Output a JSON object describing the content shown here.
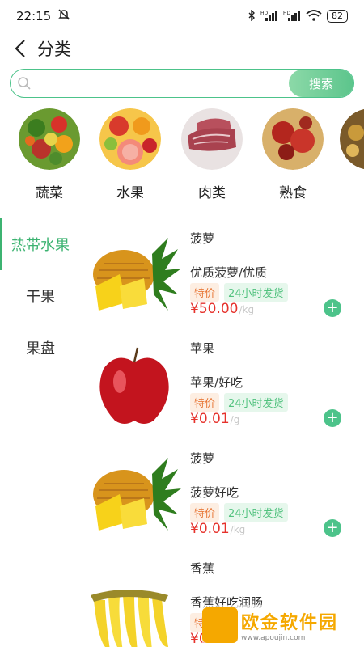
{
  "status_bar": {
    "time": "22:15",
    "network_left": "HD",
    "network_right": "HD",
    "battery": "82"
  },
  "header": {
    "title": "分类"
  },
  "search": {
    "placeholder": "",
    "value": "",
    "button_label": "搜索"
  },
  "categories": [
    {
      "label": "蔬菜",
      "icon": "vegetables-image"
    },
    {
      "label": "水果",
      "icon": "fruits-image"
    },
    {
      "label": "肉类",
      "icon": "meat-image"
    },
    {
      "label": "熟食",
      "icon": "cooked-food-image"
    }
  ],
  "side_nav": [
    {
      "label": "热带水果",
      "active": true
    },
    {
      "label": "干果",
      "active": false
    },
    {
      "label": "果盘",
      "active": false
    }
  ],
  "products": [
    {
      "name": "菠萝",
      "desc": "优质菠萝/优质",
      "tag_special": "特价",
      "tag_ship": "24小时发货",
      "price": "¥50.00",
      "unit": "/kg",
      "image": "pineapple-image"
    },
    {
      "name": "苹果",
      "desc": "苹果/好吃",
      "tag_special": "特价",
      "tag_ship": "24小时发货",
      "price": "¥0.01",
      "unit": "/g",
      "image": "apple-image"
    },
    {
      "name": "菠萝",
      "desc": "菠萝好吃",
      "tag_special": "特价",
      "tag_ship": "24小时发货",
      "price": "¥0.01",
      "unit": "/kg",
      "image": "pineapple-image"
    },
    {
      "name": "香蕉",
      "desc": "香蕉好吃润肠",
      "tag_special": "特",
      "tag_ship": "",
      "price": "¥0.0",
      "unit": "",
      "image": "banana-image"
    }
  ],
  "watermark": {
    "name": "欧金软件园",
    "url": "www.apoujin.com"
  },
  "colors": {
    "accent": "#3cb371",
    "price": "#e6322c"
  }
}
